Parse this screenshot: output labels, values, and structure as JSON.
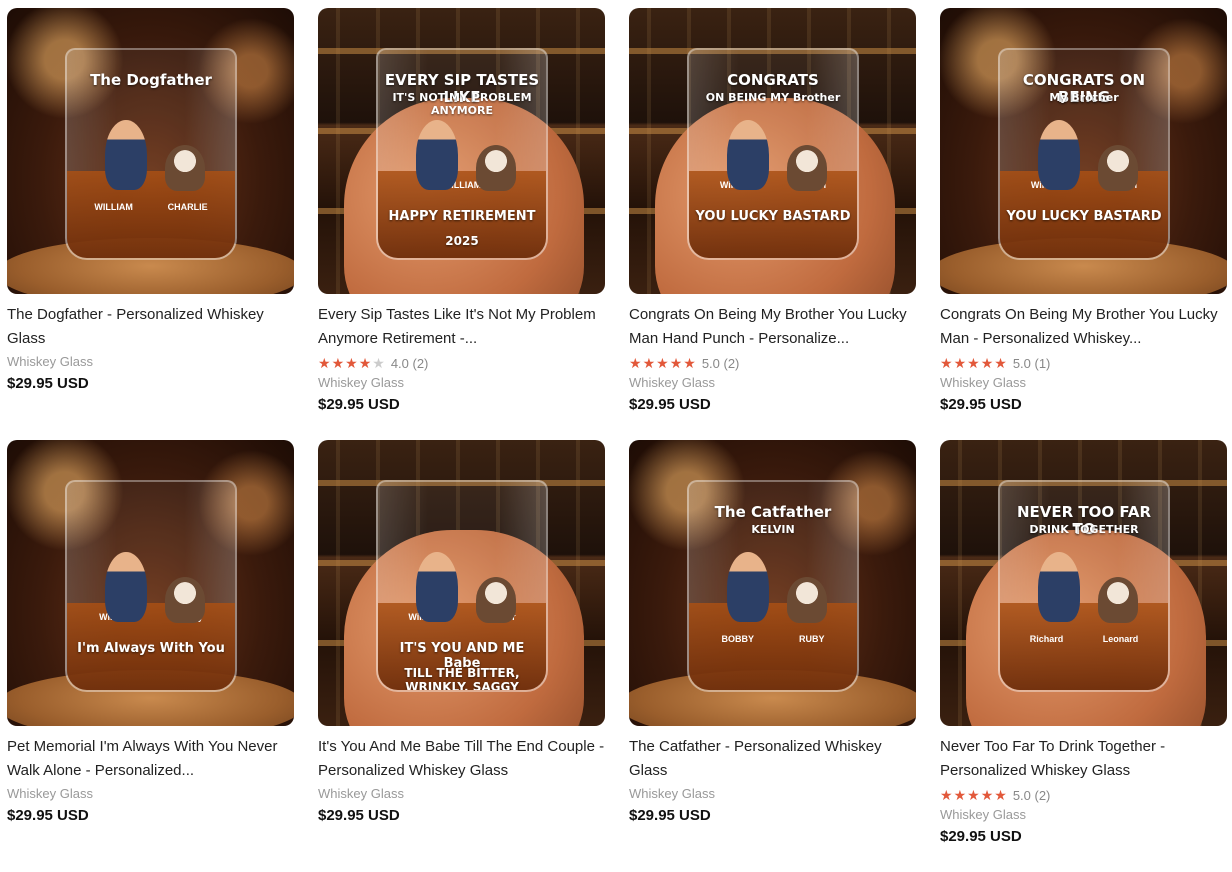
{
  "products": [
    {
      "title": "The Dogfather - Personalized Whiskey Glass",
      "category": "Whiskey Glass",
      "price": "$29.95 USD",
      "rating": null,
      "image": {
        "line1": "The Dogfather",
        "names": [
          "WILLIAM",
          "CHARLIE"
        ],
        "style": "board"
      }
    },
    {
      "title": "Every Sip Tastes Like It's Not My Problem Anymore Retirement -...",
      "category": "Whiskey Glass",
      "price": "$29.95 USD",
      "rating": {
        "stars": 4,
        "text": "4.0 (2)"
      },
      "image": {
        "line1": "EVERY SIP TASTES LIKE",
        "line1b": "IT'S NOT MY PROBLEM ANYMORE",
        "names": [
          "WILLIAM"
        ],
        "line2": "HAPPY RETIREMENT",
        "line3": "2025",
        "style": "hand"
      }
    },
    {
      "title": "Congrats On Being My Brother You Lucky Man Hand Punch - Personalize...",
      "category": "Whiskey Glass",
      "price": "$29.95 USD",
      "rating": {
        "stars": 5,
        "text": "5.0 (2)"
      },
      "image": {
        "line1": "CONGRATS",
        "line1b": "ON BEING MY Brother",
        "names": [
          "William",
          "Michael"
        ],
        "line2": "YOU LUCKY BASTARD",
        "style": "hand"
      }
    },
    {
      "title": "Congrats On Being My Brother You Lucky Man - Personalized Whiskey...",
      "category": "Whiskey Glass",
      "price": "$29.95 USD",
      "rating": {
        "stars": 5,
        "text": "5.0 (1)"
      },
      "image": {
        "line1": "CONGRATS ON BEING",
        "line1b": "My Brother",
        "names": [
          "William",
          "Michael"
        ],
        "line2": "YOU LUCKY BASTARD",
        "style": "board"
      }
    },
    {
      "title": "Pet Memorial I'm Always With You Never Walk Alone - Personalized...",
      "category": "Whiskey Glass",
      "price": "$29.95 USD",
      "rating": null,
      "image": {
        "names": [
          "William",
          "Buddy"
        ],
        "line2": "I'm Always With You",
        "style": "board"
      }
    },
    {
      "title": "It's You And Me Babe Till The End Couple - Personalized Whiskey Glass",
      "category": "Whiskey Glass",
      "price": "$29.95 USD",
      "rating": null,
      "image": {
        "names": [
          "William",
          "Jennifer"
        ],
        "line2": "IT'S YOU AND ME Babe",
        "line3": "TILL THE BITTER, WRINKLY, SAGGY END...",
        "style": "hand"
      }
    },
    {
      "title": "The Catfather - Personalized Whiskey Glass",
      "category": "Whiskey Glass",
      "price": "$29.95 USD",
      "rating": null,
      "image": {
        "line1": "The Catfather",
        "line1b": "KELVIN",
        "names": [
          "BOBBY",
          "RUBY"
        ],
        "style": "board"
      }
    },
    {
      "title": "Never Too Far To Drink Together - Personalized Whiskey Glass",
      "category": "Whiskey Glass",
      "price": "$29.95 USD",
      "rating": {
        "stars": 5,
        "text": "5.0 (2)"
      },
      "image": {
        "line1": "NEVER TOO FAR TO",
        "line1b": "DRINK TOGETHER",
        "names": [
          "Richard",
          "Leonard"
        ],
        "style": "hand"
      }
    }
  ],
  "colors": {
    "star": "#e2583a",
    "star_empty": "#cccccc",
    "price": "#111111",
    "meta": "#999999"
  }
}
